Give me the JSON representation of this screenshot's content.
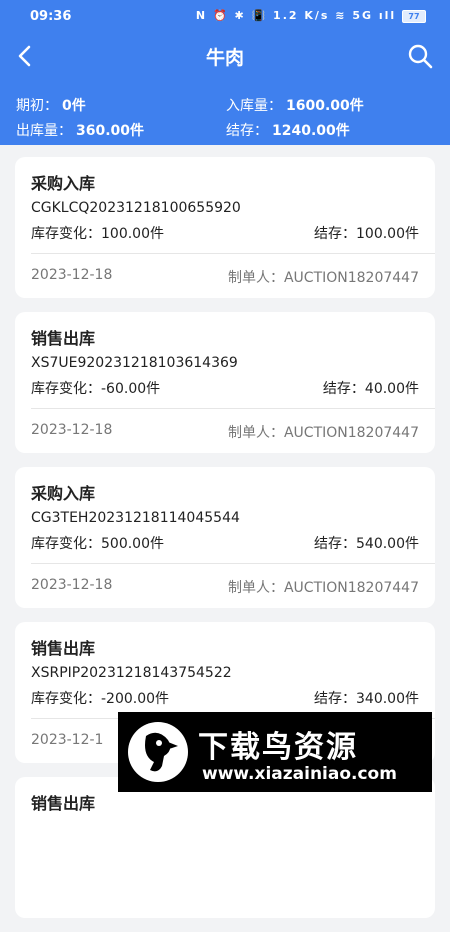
{
  "status_bar": {
    "time": "09:36",
    "indicators": "N ⏰ ✱ 📳 1.2 K/s ≋ 5G ıll",
    "battery": "77"
  },
  "navbar": {
    "title": "牛肉"
  },
  "summary": {
    "opening_label": "期初：",
    "opening_value": "0件",
    "inbound_label": "入库量：",
    "inbound_value": "1600.00件",
    "outbound_label": "出库量：",
    "outbound_value": "360.00件",
    "balance_label": "结存：",
    "balance_value": "1240.00件"
  },
  "records": [
    {
      "title": "采购入库",
      "order_no": "CGKLCQ20231218100655920",
      "change": "库存变化：100.00件",
      "balance": "结存：100.00件",
      "date": "2023-12-18",
      "maker": "制单人：AUCTION18207447"
    },
    {
      "title": "销售出库",
      "order_no": "XS7UE920231218103614369",
      "change": "库存变化：-60.00件",
      "balance": "结存：40.00件",
      "date": "2023-12-18",
      "maker": "制单人：AUCTION18207447"
    },
    {
      "title": "采购入库",
      "order_no": "CG3TEH20231218114045544",
      "change": "库存变化：500.00件",
      "balance": "结存：540.00件",
      "date": "2023-12-18",
      "maker": "制单人：AUCTION18207447"
    },
    {
      "title": "销售出库",
      "order_no": "XSRPIP20231218143754522",
      "change": "库存变化：-200.00件",
      "balance": "结存：340.00件",
      "date": "2023-12-1",
      "maker": ""
    },
    {
      "title": "销售出库",
      "order_no": "",
      "change": "",
      "balance": "",
      "date": "",
      "maker": ""
    }
  ],
  "watermark": {
    "name": "下载鸟资源",
    "url": "www.xiazainiao.com"
  },
  "colors": {
    "header": "#3f80ee",
    "background": "#f2f3f5",
    "card": "#ffffff"
  },
  "icons": {
    "back": "chevron-left-icon",
    "search": "search-icon"
  }
}
